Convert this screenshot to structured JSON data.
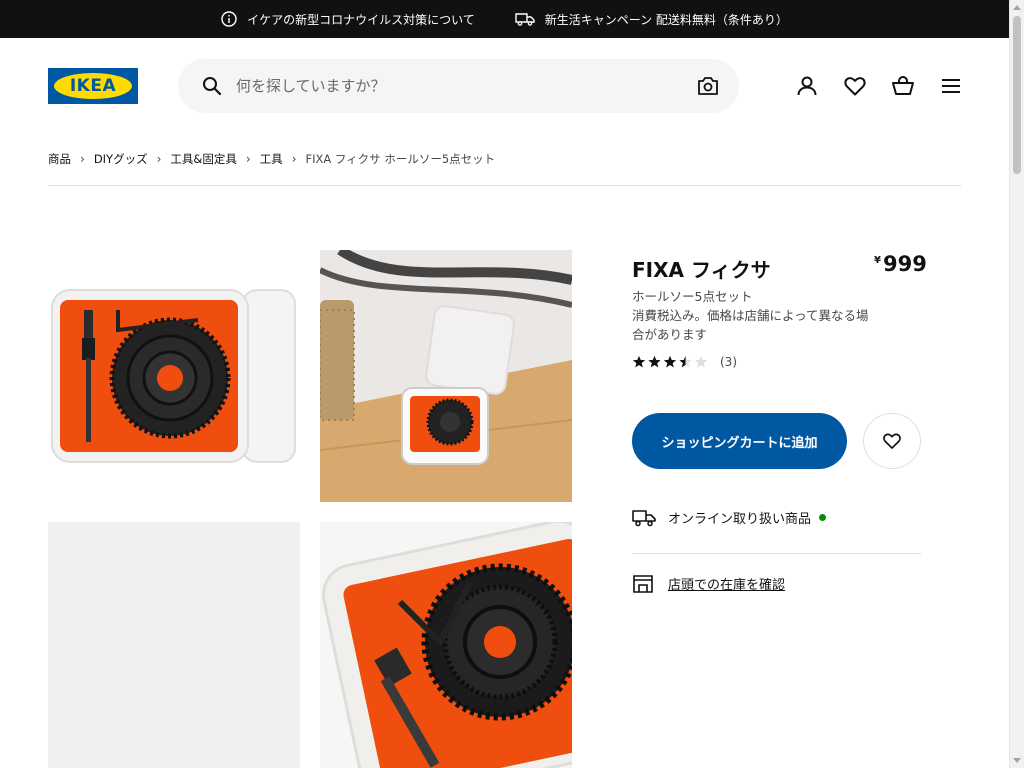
{
  "banner": {
    "info_text": "イケアの新型コロナウイルス対策について",
    "campaign_text": "新生活キャンペーン 配送料無料（条件あり）"
  },
  "header": {
    "logo_text": "IKEA",
    "search_placeholder": "何を探していますか？",
    "icons": [
      "user-icon",
      "heart-icon",
      "cart-icon",
      "menu-icon"
    ]
  },
  "breadcrumb": {
    "items": [
      "商品",
      "DIYグッズ",
      "工具&固定具",
      "工具"
    ],
    "current": "FIXA フィクサ ホールソー5点セット"
  },
  "product": {
    "name": "FIXA フィクサ",
    "currency": "¥",
    "price": "999",
    "description": "ホールソー5点セット",
    "note": "消費税込み。価格は店舗によって異なる場合があります",
    "rating_value": 3.5,
    "rating_max": 5,
    "review_count": "(3)",
    "add_to_cart": "ショッピングカートに追加",
    "availability": "オンライン取り扱い商品",
    "store_check": "店頭での在庫を確認"
  },
  "colors": {
    "ikea_blue": "#0058a3",
    "ikea_yellow": "#ffdb00",
    "available_green": "#0a8a00"
  }
}
